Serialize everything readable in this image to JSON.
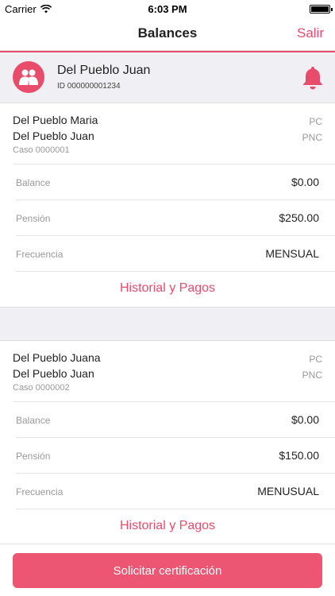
{
  "status_bar": {
    "carrier": "Carrier",
    "time": "6:03 PM"
  },
  "nav": {
    "title": "Balances",
    "logout_label": "Salir"
  },
  "user": {
    "name": "Del Pueblo Juan",
    "id_text": "ID 000000001234"
  },
  "cases": [
    {
      "name1": "Del Pueblo Maria",
      "tag1": "PC",
      "name2": "Del Pueblo Juan",
      "tag2": "PNC",
      "case_number": "Caso 0000001",
      "rows": [
        {
          "label": "Balance",
          "value": "$0.00"
        },
        {
          "label": "Pensión",
          "value": "$250.00"
        },
        {
          "label": "Frecuencia",
          "value": "MENSUAL"
        }
      ],
      "link_label": "Historial y Pagos"
    },
    {
      "name1": "Del Pueblo Juana",
      "tag1": "PC",
      "name2": "Del Pueblo Juan",
      "tag2": "PNC",
      "case_number": "Caso 0000002",
      "rows": [
        {
          "label": "Balance",
          "value": "$0.00"
        },
        {
          "label": "Pensión",
          "value": "$150.00"
        },
        {
          "label": "Frecuencia",
          "value": "MENUSUAL"
        }
      ],
      "link_label": "Historial y Pagos"
    }
  ],
  "cta_label": "Solicitar certificación",
  "colors": {
    "accent": "#e94b6a",
    "button": "#ec5672",
    "group_background": "#efeff4"
  },
  "icons": {
    "avatar": "users-icon",
    "notification": "bell-icon"
  }
}
